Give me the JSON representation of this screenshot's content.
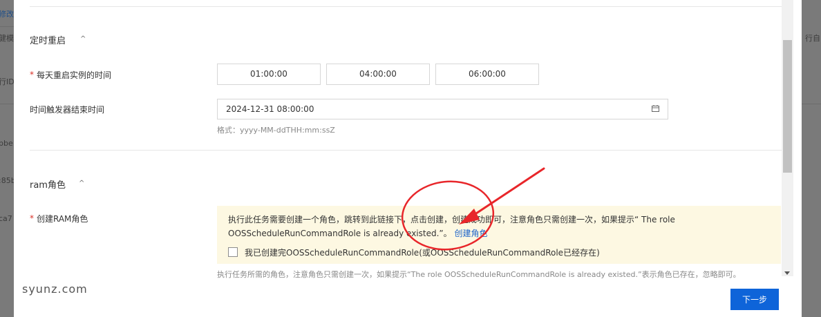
{
  "background": {
    "fragments_left": [
      "修改",
      "健模",
      "行ID",
      "bbe",
      ":85b",
      "ca7"
    ],
    "fragment_right": "行自"
  },
  "sections": {
    "schedule": {
      "title": "定时重启",
      "caret": "^"
    },
    "ram": {
      "title": "ram角色",
      "caret": "^"
    }
  },
  "form": {
    "restart_time": {
      "required_mark": "*",
      "label": "每天重启实例的时间",
      "times": [
        "01:00:00",
        "04:00:00",
        "06:00:00"
      ]
    },
    "trigger_end": {
      "label": "时间触发器结束时间",
      "value": "2024-12-31 08:00:00",
      "hint": "格式：yyyy-MM-ddTHH:mm:ssZ"
    },
    "ram_role": {
      "required_mark": "*",
      "label": "创建RAM角色",
      "notice_text": "执行此任务需要创建一个角色，跳转到此链接下，点击创建，创建成功即可，注意角色只需创建一次，如果提示“ The role OOSScheduleRunCommandRole is already existed.”。",
      "notice_link": "创建角色",
      "checkbox_label": "我已创建完OOSScheduleRunCommandRole(或OOSScheduleRunCommandRole已经存在)",
      "checkbox_checked": false,
      "helper_text": "执行任务所需的角色，注意角色只需创建一次，如果提示“The role OOSScheduleRunCommandRole is already existed.”表示角色已存在，忽略即可。"
    }
  },
  "footer": {
    "next_label": "下一步"
  },
  "watermark": "syunz.com",
  "colors": {
    "primary": "#0e64d9",
    "required": "#d93026",
    "notice_bg": "#fdf8e2",
    "annotation": "#e8262a"
  }
}
